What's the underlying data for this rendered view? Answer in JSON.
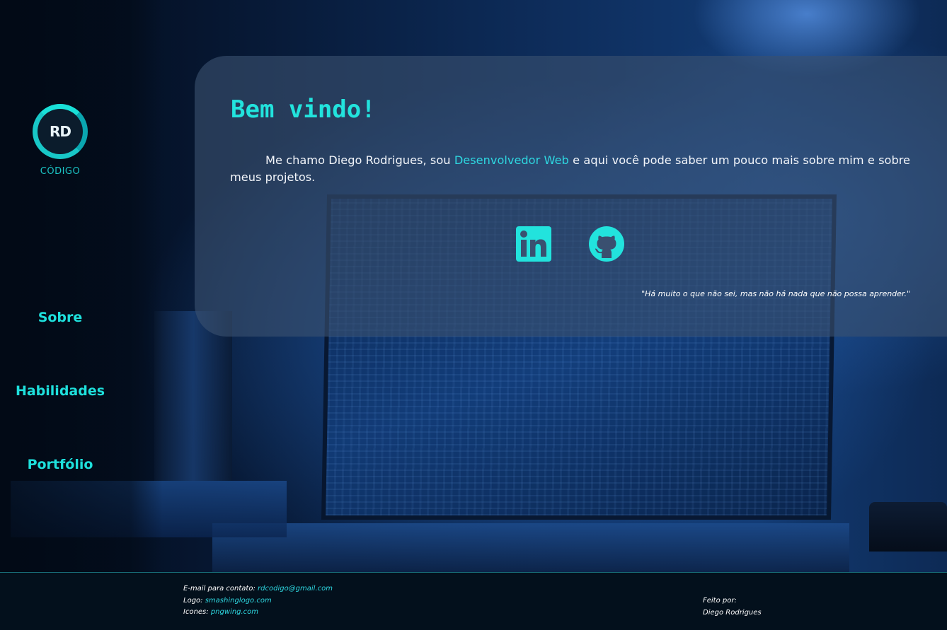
{
  "theme": {
    "accent": "#1ee0dc",
    "card_bg": "#3a5070",
    "footer_bg": "#03101c"
  },
  "sidebar": {
    "logo": {
      "initials": "RD",
      "word": "CÓDIGO"
    },
    "nav": [
      {
        "label": "Sobre"
      },
      {
        "label": "Habilidades"
      },
      {
        "label": "Portfólio"
      }
    ]
  },
  "welcome": {
    "title": "Bem vindo!",
    "intro_before": "Me chamo Diego Rodrigues, sou ",
    "intro_highlight": "Desenvolvedor Web",
    "intro_after": " e aqui você pode saber um pouco mais sobre mim e sobre meus projetos.",
    "social": [
      {
        "icon": "linkedin-icon"
      },
      {
        "icon": "github-icon"
      }
    ],
    "quote": "\"Há muito o que não sei, mas não há nada que não possa aprender.\""
  },
  "footer": {
    "email_label": "E-mail para contato: ",
    "email": "rdcodigo@gmail.com",
    "logo_label": "Logo: ",
    "logo_credit": "smashinglogo.com",
    "icons_label": "Icones: ",
    "icons_credit": "pngwing.com",
    "made_by_label": "Feito por:",
    "made_by_name": "Diego Rodrigues"
  }
}
